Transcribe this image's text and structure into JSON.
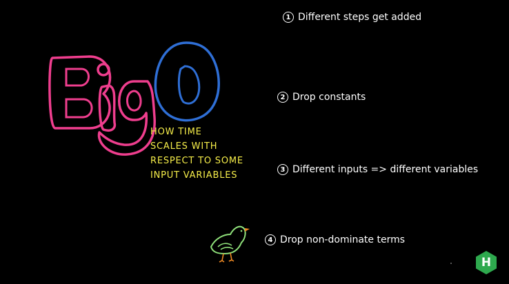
{
  "slide": {
    "subtitle_lines": [
      "HOW TIME",
      "SCALES WITH",
      "RESPECT TO SOME",
      "INPUT VARIABLES"
    ],
    "rules": [
      {
        "number": "1",
        "text": "Different steps get added"
      },
      {
        "number": "2",
        "text": "Drop constants"
      },
      {
        "number": "3",
        "text": "Different inputs => different variables"
      },
      {
        "number": "4",
        "text": "Drop non-dominate terms"
      }
    ],
    "brand_badge": {
      "letter": "H",
      "color": "#2ea94e"
    },
    "icons": {
      "logo": "big-o-logo-icon",
      "bird": "bird-doodle-icon",
      "badge": "hexagon-h-logo-icon"
    },
    "colors": {
      "background": "#000000",
      "big_letters": "#ef3e8e",
      "o_letter": "#2f6fd6",
      "subtitle": "#f7ef4a",
      "rule_text": "#ffffff",
      "bird_body": "#8fe07a",
      "bird_beak": "#f08a24"
    }
  }
}
